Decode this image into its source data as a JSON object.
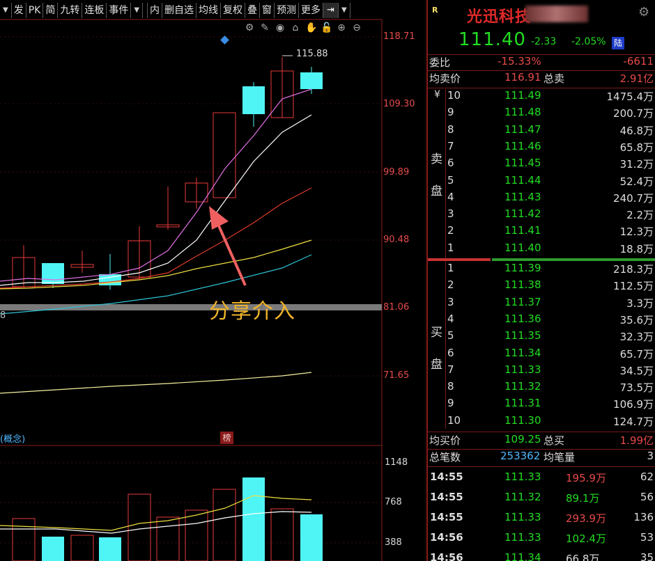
{
  "toolbar": {
    "items": [
      "发",
      "PK",
      "简",
      "九转",
      "连板",
      "事件",
      "内",
      "删自选",
      "均线",
      "复权",
      "叠",
      "窗",
      "预测",
      "更多"
    ]
  },
  "chart": {
    "price_ticks": [
      "118.71",
      "109.30",
      "99.89",
      "90.48",
      "81.06",
      "71.65"
    ],
    "volume_ticks": [
      "1148",
      "768",
      "388"
    ],
    "high_label": "115.88",
    "annotation": "分享介入",
    "concept_label": "(概念)",
    "rank_badge": "榜",
    "left_cut_value": "8",
    "colors": {
      "up": "#e83a3a",
      "down": "#4ff5f5",
      "ma5": "#e070e0",
      "ma10": "#ffffff",
      "ma20": "#e23a2a",
      "ma30": "#f0e040",
      "ma60": "#2cc4d8",
      "ma120": "#f4f0a0",
      "annotation": "#f0b42b"
    }
  },
  "stock": {
    "badge": "R",
    "name": "光迅科技",
    "price": "111.40",
    "change": "-2.33",
    "change_pct": "-2.05%",
    "market_tag": "陆"
  },
  "summary": {
    "weibi_label": "委比",
    "weibi_pct": "-15.33%",
    "weibi_diff": "-6611",
    "avg_sell_label": "均卖价",
    "avg_sell": "116.91",
    "total_sell_label": "总卖",
    "total_sell": "2.91亿",
    "avg_buy_label": "均买价",
    "avg_buy": "109.25",
    "total_buy_label": "总买",
    "total_buy": "1.99亿",
    "trades_label": "总笔数",
    "trades": "253362",
    "avg_vol_label": "均笔量",
    "avg_vol": "3"
  },
  "sell_side": {
    "symbol": "¥",
    "label_top": "卖",
    "label_bottom": "盘",
    "levels": [
      {
        "level": "10",
        "price": "111.49",
        "volume": "1475.4万"
      },
      {
        "level": "9",
        "price": "111.48",
        "volume": "200.7万"
      },
      {
        "level": "8",
        "price": "111.47",
        "volume": "46.8万"
      },
      {
        "level": "7",
        "price": "111.46",
        "volume": "65.8万"
      },
      {
        "level": "6",
        "price": "111.45",
        "volume": "31.2万"
      },
      {
        "level": "5",
        "price": "111.44",
        "volume": "52.4万"
      },
      {
        "level": "4",
        "price": "111.43",
        "volume": "240.7万"
      },
      {
        "level": "3",
        "price": "111.42",
        "volume": "2.2万"
      },
      {
        "level": "2",
        "price": "111.41",
        "volume": "12.3万"
      },
      {
        "level": "1",
        "price": "111.40",
        "volume": "18.8万"
      }
    ]
  },
  "buy_side": {
    "label_top": "买",
    "label_bottom": "盘",
    "levels": [
      {
        "level": "1",
        "price": "111.39",
        "volume": "218.3万"
      },
      {
        "level": "2",
        "price": "111.38",
        "volume": "112.5万"
      },
      {
        "level": "3",
        "price": "111.37",
        "volume": "3.3万"
      },
      {
        "level": "4",
        "price": "111.36",
        "volume": "35.6万"
      },
      {
        "level": "5",
        "price": "111.35",
        "volume": "32.3万"
      },
      {
        "level": "6",
        "price": "111.34",
        "volume": "65.7万"
      },
      {
        "level": "7",
        "price": "111.33",
        "volume": "34.5万"
      },
      {
        "level": "8",
        "price": "111.32",
        "volume": "73.5万"
      },
      {
        "level": "9",
        "price": "111.31",
        "volume": "106.9万"
      },
      {
        "level": "10",
        "price": "111.30",
        "volume": "124.7万"
      }
    ]
  },
  "ticks": [
    {
      "time": "14:55",
      "price": "111.33",
      "amount": "195.9万",
      "amount_color": "#e84a4a",
      "count": "62"
    },
    {
      "time": "14:55",
      "price": "111.32",
      "amount": "89.1万",
      "amount_color": "#22dd22",
      "count": "56"
    },
    {
      "time": "14:55",
      "price": "111.33",
      "amount": "293.9万",
      "amount_color": "#e84a4a",
      "count": "136"
    },
    {
      "time": "14:56",
      "price": "111.33",
      "amount": "102.4万",
      "amount_color": "#22dd22",
      "count": "53"
    },
    {
      "time": "14:56",
      "price": "111.34",
      "amount": "66.8万",
      "amount_color": "#ddd",
      "count": "35"
    }
  ]
}
